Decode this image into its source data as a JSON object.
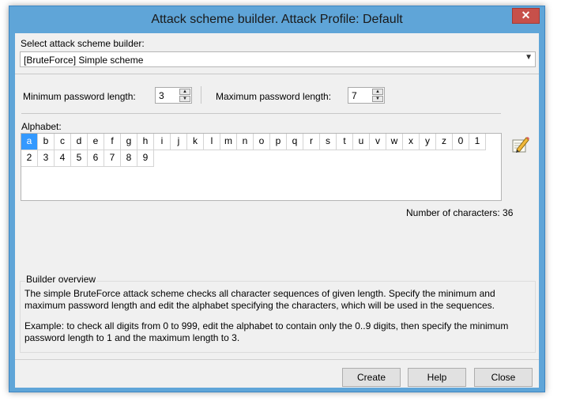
{
  "window": {
    "title": "Attack scheme builder. Attack Profile: Default",
    "close_glyph": "✕"
  },
  "builder": {
    "label": "Select attack scheme builder:",
    "selected": "[BruteForce] Simple scheme"
  },
  "password": {
    "min_label": "Minimum password length:",
    "min_value": "3",
    "max_label": "Maximum password length:",
    "max_value": "7"
  },
  "alphabet": {
    "label": "Alphabet:",
    "row1": [
      "a",
      "b",
      "c",
      "d",
      "e",
      "f",
      "g",
      "h",
      "i",
      "j",
      "k",
      "l",
      "m",
      "n",
      "o",
      "p",
      "q",
      "r",
      "s",
      "t",
      "u",
      "v",
      "w",
      "x",
      "y",
      "z",
      "0",
      "1"
    ],
    "row2": [
      "2",
      "3",
      "4",
      "5",
      "6",
      "7",
      "8",
      "9"
    ],
    "selected": "a",
    "count_text": "Number of characters: 36"
  },
  "overview": {
    "title": "Builder overview",
    "paragraph1": "The simple BruteForce attack scheme checks all character sequences of given length. Specify the minimum and maximum password length and edit the alphabet specifying the characters, which will be used in the sequences.",
    "paragraph2": "Example: to check all digits from 0 to 999, edit the alphabet to contain only the 0..9 digits, then specify the minimum password length to 1 and the maximum length to 3."
  },
  "buttons": {
    "create": "Create",
    "help": "Help",
    "close": "Close"
  },
  "icons": {
    "edit_alphabet": "pencil-edit-icon",
    "dropdown": "chevron-down-icon",
    "close": "close-icon"
  }
}
